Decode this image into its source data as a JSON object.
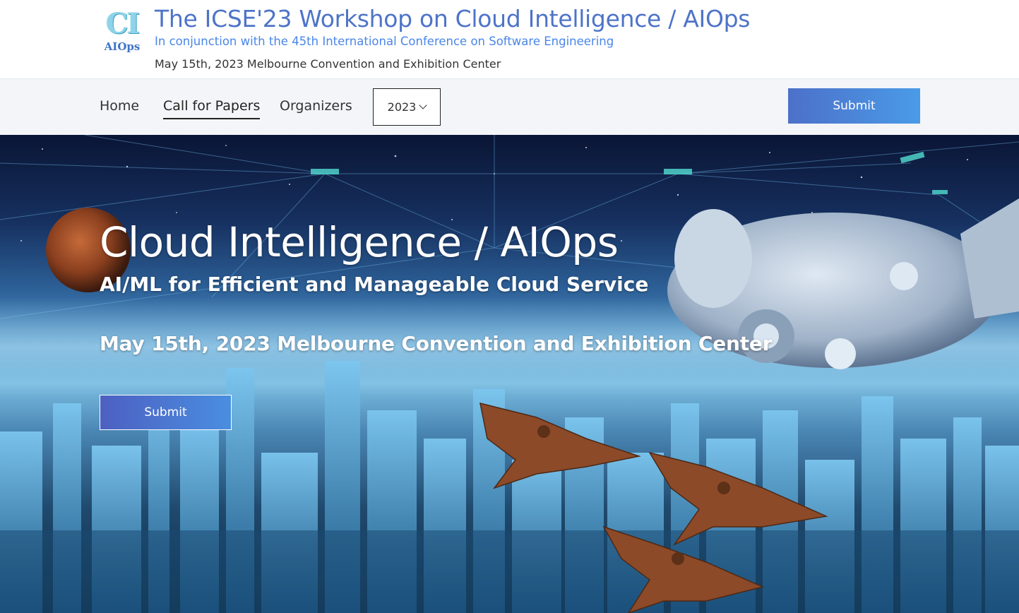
{
  "header": {
    "logo_top": "CI",
    "logo_bottom": "AIOps",
    "title": "The ICSE'23 Workshop on Cloud Intelligence / AIOps",
    "subtitle": "In conjunction with the 45th International Conference on Software Engineering",
    "date_location": "May 15th, 2023 Melbourne Convention and Exhibition Center"
  },
  "nav": {
    "items": [
      {
        "label": "Home",
        "active": false
      },
      {
        "label": "Call for Papers",
        "active": true
      },
      {
        "label": "Organizers",
        "active": false
      }
    ],
    "year_select": {
      "value": "2023",
      "icon": "chevron-down-icon"
    },
    "submit_label": "Submit"
  },
  "hero": {
    "title": "Cloud Intelligence / AIOps",
    "subtitle": "AI/ML for Efficient and Manageable Cloud Service",
    "date_location": "May 15th, 2023 Melbourne Convention and Exhibition Center",
    "submit_label": "Submit",
    "background_description": "sci-fi city",
    "colors": {
      "accent_start": "#4d70c9",
      "accent_end": "#4a9be8",
      "title_color": "#4e74c8",
      "subtitle_color": "#4a86e8"
    }
  }
}
